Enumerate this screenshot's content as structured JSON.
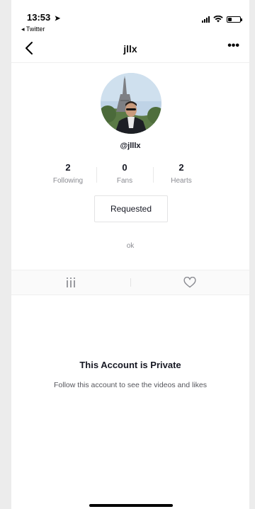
{
  "status_bar": {
    "time": "13:53",
    "location_arrow": "➤",
    "back_app": "◂ Twitter",
    "icons": [
      "signal-icon",
      "wifi-icon",
      "battery-icon"
    ],
    "battery_level": 0.3
  },
  "navbar": {
    "title": "jllx",
    "back_icon": "chevron-left-icon",
    "more_icon": "more-dots-icon",
    "more_label": "•••"
  },
  "profile": {
    "handle": "@jlllx",
    "stats": [
      {
        "value": "2",
        "label": "Following"
      },
      {
        "value": "0",
        "label": "Fans"
      },
      {
        "value": "2",
        "label": "Hearts"
      }
    ],
    "follow_button": "Requested",
    "bio": "ok"
  },
  "tabs": [
    {
      "icon": "video-grid-icon"
    },
    {
      "icon": "heart-outline-icon"
    }
  ],
  "private_notice": {
    "title": "This Account is Private",
    "description": "Follow this account to see the videos and likes"
  },
  "colors": {
    "text_primary": "#161823",
    "text_secondary": "#8a8b91",
    "border": "#e3e3e4",
    "background": "#ffffff"
  }
}
